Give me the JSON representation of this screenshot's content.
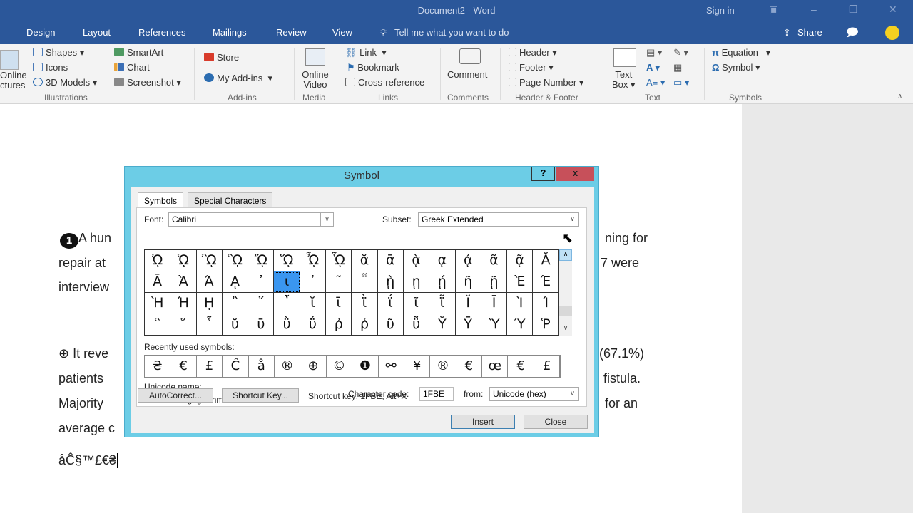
{
  "window": {
    "title": "Document2 - Word",
    "sign_in": "Sign in"
  },
  "tabs": [
    "Design",
    "Layout",
    "References",
    "Mailings",
    "Review",
    "View"
  ],
  "tell_me": "Tell me what you want to do",
  "share": "Share",
  "ribbon": {
    "online_pictures": [
      "Online",
      "ctures"
    ],
    "shapes": "Shapes",
    "icons": "Icons",
    "models3d": "3D Models",
    "smartart": "SmartArt",
    "chart": "Chart",
    "screenshot": "Screenshot",
    "illustrations": "Illustrations",
    "store": "Store",
    "my_addins": "My Add-ins",
    "addins": "Add-ins",
    "online_video": [
      "Online",
      "Video"
    ],
    "media": "Media",
    "link": "Link",
    "bookmark": "Bookmark",
    "cross_reference": "Cross-reference",
    "links": "Links",
    "comment": "Comment",
    "comments": "Comments",
    "header": "Header",
    "footer": "Footer",
    "page_number": "Page Number",
    "header_footer": "Header & Footer",
    "text_box": [
      "Text",
      "Box"
    ],
    "text": "Text",
    "equation": "Equation",
    "symbol": "Symbol",
    "symbols": "Symbols"
  },
  "document": {
    "lines": [
      {
        "left": "A hun",
        "right": "ning for",
        "bullet": "1"
      },
      {
        "left": "repair  at",
        "right": "7  were"
      },
      {
        "left": "interview",
        "right": ""
      },
      {
        "left": "⊕  It  reve",
        "right": "(67.1%)"
      },
      {
        "left": "patients",
        "right": "fistula."
      },
      {
        "left": "Majority",
        "right": "for  an"
      },
      {
        "left": "average c",
        "right": ""
      },
      {
        "left": "åĈ§™£€₴",
        "right": ""
      }
    ]
  },
  "dialog": {
    "title": "Symbol",
    "help": "?",
    "close_x": "x",
    "tabs": [
      "Symbols",
      "Special Characters"
    ],
    "font_label": "Font:",
    "font_value": "Calibri",
    "subset_label": "Subset:",
    "subset_value": "Greek Extended",
    "symbols": [
      [
        "ᾨ",
        "ᾩ",
        "ᾪ",
        "ᾫ",
        "ᾬ",
        "ᾭ",
        "ᾮ",
        "ᾯ",
        "ᾰ",
        "ᾱ",
        "ᾲ",
        "ᾳ",
        "ᾴ",
        "ᾶ",
        "ᾷ",
        "Ᾰ"
      ],
      [
        "Ᾱ",
        "Ὰ",
        "Ά",
        "ᾼ",
        "᾽",
        "ι",
        "᾿",
        "῀",
        "῁",
        "ῂ",
        "ῃ",
        "ῄ",
        "ῆ",
        "ῇ",
        "Ὲ",
        "Έ"
      ],
      [
        "Ὴ",
        "Ή",
        "ῌ",
        "῍",
        "῎",
        "῏",
        "ῐ",
        "ῑ",
        "ῒ",
        "ΐ",
        "ῖ",
        "ῗ",
        "Ῐ",
        "Ῑ",
        "Ὶ",
        "Ί"
      ],
      [
        "῝",
        "῞",
        "῟",
        "ῠ",
        "ῡ",
        "ῢ",
        "ΰ",
        "ῤ",
        "ῥ",
        "ῦ",
        "ῧ",
        "Ῠ",
        "Ῡ",
        "Ὺ",
        "Ύ",
        "Ῥ"
      ]
    ],
    "selected_symbol": "ι",
    "recent_label": "Recently used symbols:",
    "recent": [
      "₴",
      "€",
      "£",
      "Ĉ",
      "å",
      "®",
      "⊕",
      "©",
      "❶",
      "⚯",
      "¥",
      "®",
      "€",
      "œ",
      "€",
      "£"
    ],
    "unicode_name_label": "Unicode name:",
    "unicode_name": "Greek Prosgegrammeni",
    "char_code_label": "Character code:",
    "char_code": "1FBE",
    "from_label": "from:",
    "from_value": "Unicode (hex)",
    "autocorrect": "AutoCorrect...",
    "shortcut_key_btn": "Shortcut Key...",
    "shortcut_text": "Shortcut key: 1FBE, Alt+X",
    "insert": "Insert",
    "close": "Close"
  },
  "colors": {
    "word_blue": "#2b579a",
    "dialog_frame": "#6ccde6",
    "close_red": "#c7505a",
    "selection": "#3a96f0"
  }
}
